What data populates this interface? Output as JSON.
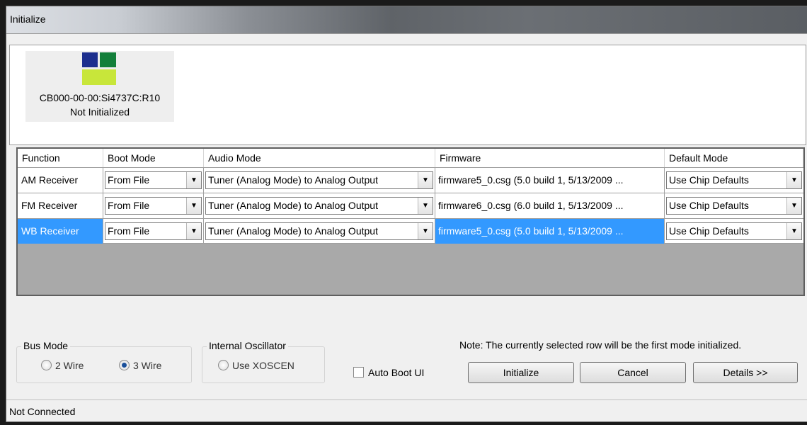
{
  "window": {
    "title": "Initialize"
  },
  "device": {
    "name": "CB000-00-00:Si4737C:R10",
    "status": "Not Initialized"
  },
  "table": {
    "columns": [
      "Function",
      "Boot Mode",
      "Audio Mode",
      "Firmware",
      "Default Mode"
    ],
    "rows": [
      {
        "function": "AM Receiver",
        "boot_mode": "From File",
        "audio_mode": "Tuner (Analog Mode) to Analog Output",
        "firmware": "firmware5_0.csg (5.0 build 1, 5/13/2009 ...",
        "default_mode": "Use Chip Defaults",
        "selected": false
      },
      {
        "function": "FM Receiver",
        "boot_mode": "From File",
        "audio_mode": "Tuner (Analog Mode) to Analog Output",
        "firmware": "firmware6_0.csg (6.0 build 1, 5/13/2009 ...",
        "default_mode": "Use Chip Defaults",
        "selected": false
      },
      {
        "function": "WB Receiver",
        "boot_mode": "From File",
        "audio_mode": "Tuner (Analog Mode) to Analog Output",
        "firmware": "firmware5_0.csg (5.0 build 1, 5/13/2009 ...",
        "default_mode": "Use Chip Defaults",
        "selected": true
      }
    ]
  },
  "bus_mode": {
    "label": "Bus Mode",
    "options": [
      "2 Wire",
      "3 Wire"
    ],
    "selected": "3 Wire"
  },
  "internal_oscillator": {
    "label": "Internal Oscillator",
    "option": "Use XOSCEN",
    "checked": false
  },
  "auto_boot": {
    "label": "Auto Boot UI",
    "checked": false
  },
  "note": "Note: The currently selected row will be the first mode initialized.",
  "buttons": {
    "initialize": "Initialize",
    "cancel": "Cancel",
    "details": "Details >>"
  },
  "status_bar": {
    "text": "Not Connected"
  },
  "colors": {
    "selection": "#3399ff",
    "chip_blue": "#1d2f8e",
    "chip_green": "#137f3a",
    "chip_lime": "#c8e63a"
  }
}
